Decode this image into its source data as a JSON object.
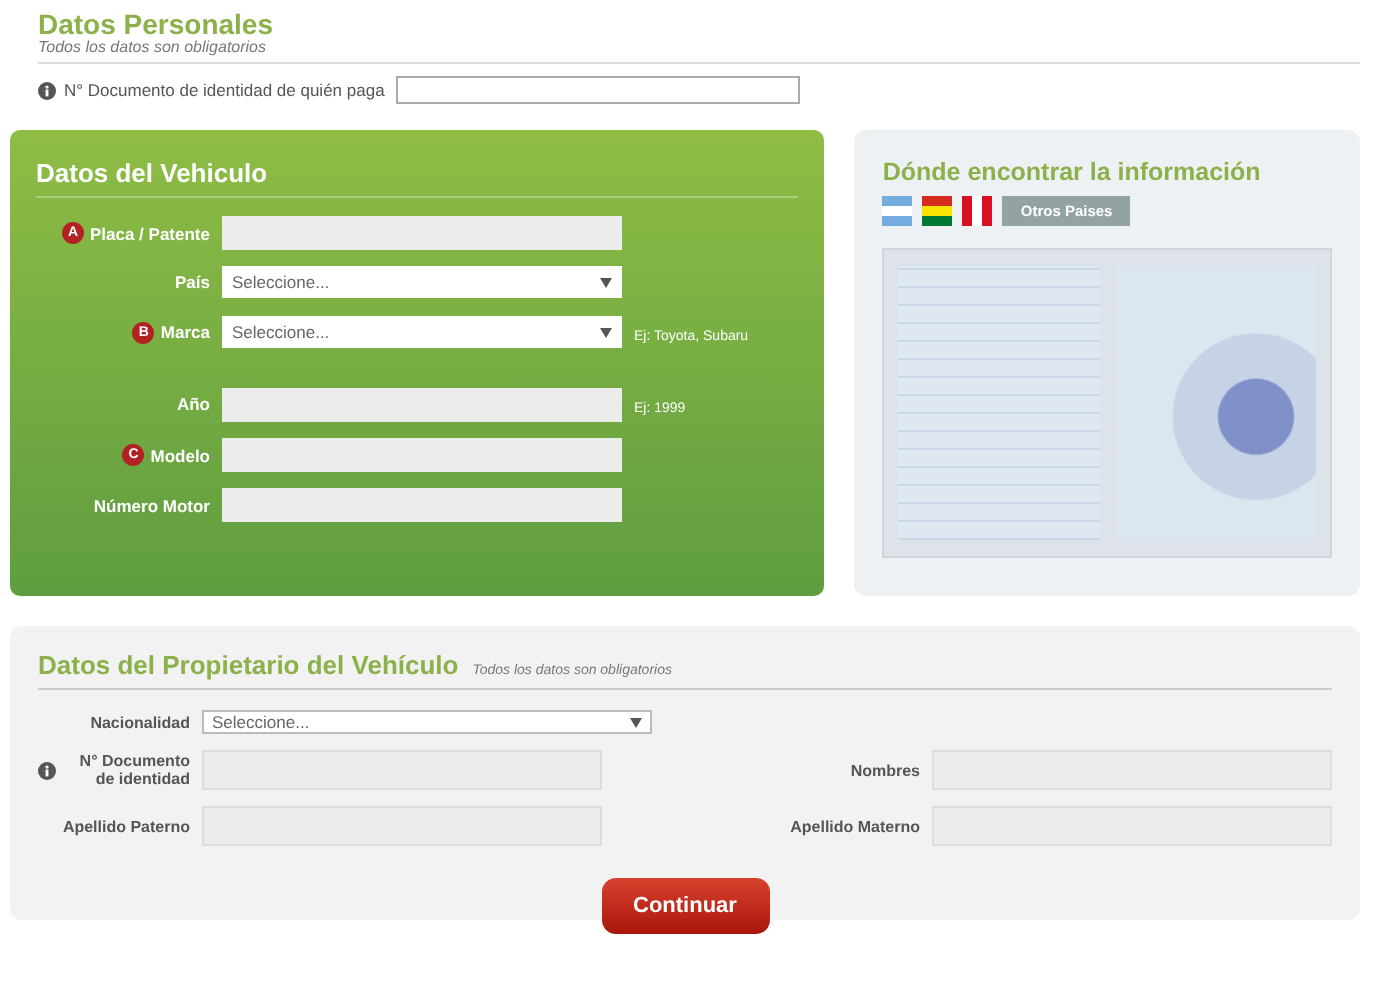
{
  "personal": {
    "title": "Datos Personales",
    "subtitle": "Todos los datos son obligatorios",
    "field": {
      "label": "N° Documento de identidad de quién paga",
      "info": true
    }
  },
  "vehicle": {
    "title": "Datos del Vehiculo",
    "fields": [
      {
        "label": "Placa / Patente",
        "badge": "A",
        "kind": "text"
      },
      {
        "label": "País",
        "kind": "select",
        "value": "Seleccione..."
      },
      {
        "label": "Marca",
        "badge": "B",
        "kind": "select",
        "value": "Seleccione...",
        "hint": "Ej: Toyota, Subaru"
      },
      {
        "label": "Año",
        "kind": "text",
        "hint": "Ej: 1999"
      },
      {
        "label": "Modelo",
        "badge": "C",
        "kind": "text"
      },
      {
        "label": "Número Motor",
        "kind": "text"
      }
    ]
  },
  "help": {
    "title": "Dónde encontrar la información",
    "flags": [
      {
        "kind": "argentina",
        "selected": false
      },
      {
        "kind": "bolivia",
        "selected": false
      },
      {
        "kind": "peru",
        "selected": false
      }
    ],
    "other_button": "Otros Paises"
  },
  "owner": {
    "title": "Datos del Propietario del Vehículo",
    "subtitle": "Todos los datos son obligatorios",
    "nationality": {
      "label": "Nacionalidad",
      "value": "Seleccione..."
    },
    "rows": [
      [
        {
          "label": "N° Documento de identidad",
          "info": true
        },
        {
          "label": "Nombres"
        }
      ],
      [
        {
          "label": "Apellido Paterno"
        },
        {
          "label": "Apellido Materno"
        }
      ]
    ]
  },
  "submit": "Continuar"
}
